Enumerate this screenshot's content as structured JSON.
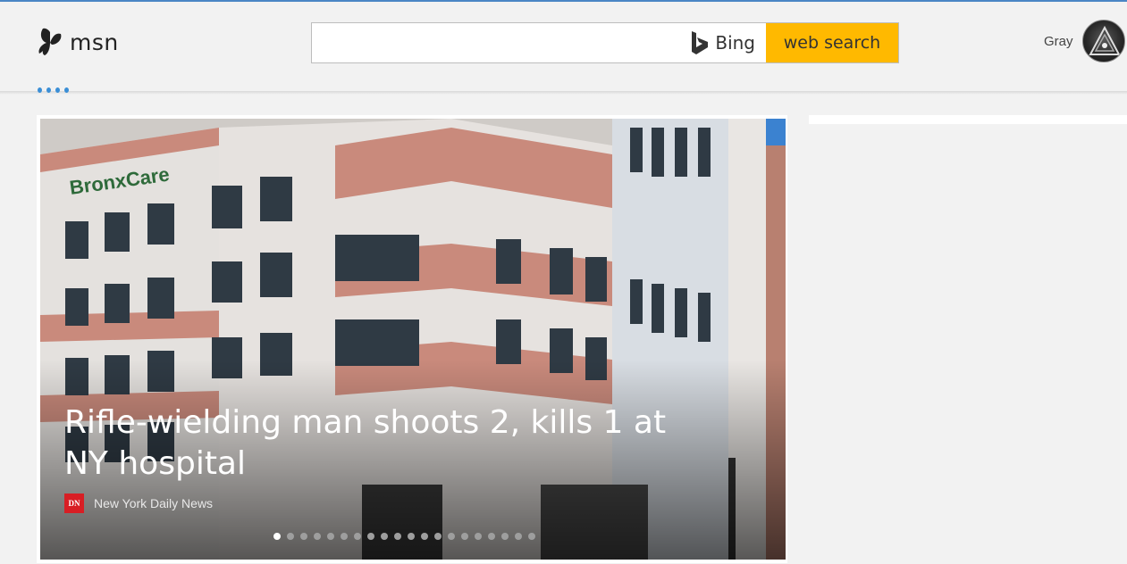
{
  "logo": {
    "text": "msn"
  },
  "search": {
    "value": "",
    "placeholder": "",
    "bing_label": "Bing",
    "button_label": "web search"
  },
  "user": {
    "name": "Gray"
  },
  "hero": {
    "headline": "Rifle-wielding man shoots 2, kills 1 at NY hospital",
    "source_logo": "DN",
    "source_name": "New York Daily News",
    "slide_count": 20,
    "active_slide": 1
  },
  "colors": {
    "search_button": "#ffb900",
    "accent": "#4a86c5",
    "source_logo": "#d81e24"
  }
}
